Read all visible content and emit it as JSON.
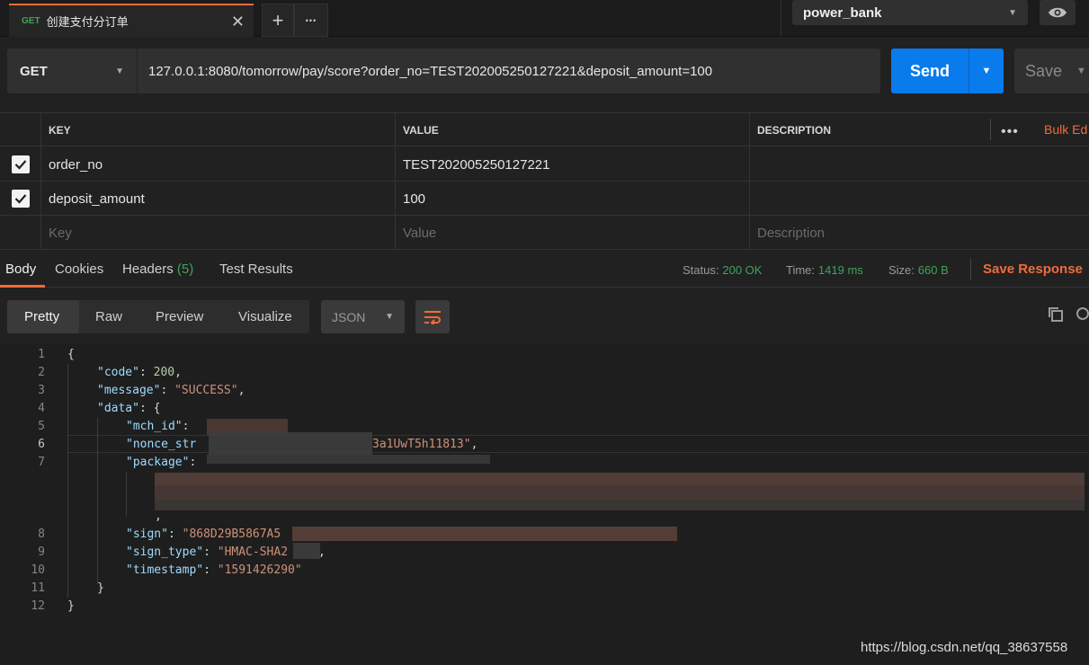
{
  "tab": {
    "method": "GET",
    "title": "创建支付分订单",
    "close": "✕",
    "add": "+",
    "more": "•••"
  },
  "environment": {
    "selected": "power_bank"
  },
  "request": {
    "method": "GET",
    "url": "127.0.0.1:8080/tomorrow/pay/score?order_no=TEST202005250127221&deposit_amount=100",
    "send_label": "Send",
    "save_label": "Save"
  },
  "params": {
    "headers": {
      "key": "KEY",
      "value": "VALUE",
      "description": "DESCRIPTION"
    },
    "bulk_edit": "Bulk Ed",
    "rows": [
      {
        "checked": true,
        "key": "order_no",
        "value": "TEST202005250127221"
      },
      {
        "checked": true,
        "key": "deposit_amount",
        "value": "100"
      }
    ],
    "placeholders": {
      "key": "Key",
      "value": "Value",
      "description": "Description"
    }
  },
  "response": {
    "tabs": {
      "body": "Body",
      "cookies": "Cookies",
      "headers": "Headers",
      "headers_count": "(5)",
      "test_results": "Test Results"
    },
    "status_label": "Status:",
    "status_value": "200 OK",
    "time_label": "Time:",
    "time_value": "1419 ms",
    "size_label": "Size:",
    "size_value": "660 B",
    "save_response": "Save Response",
    "views": {
      "pretty": "Pretty",
      "raw": "Raw",
      "preview": "Preview",
      "visualize": "Visualize"
    },
    "format": "JSON"
  },
  "editor": {
    "line_numbers": [
      "1",
      "2",
      "3",
      "4",
      "5",
      "6",
      "7",
      "8",
      "9",
      "10",
      "11",
      "12"
    ],
    "open_brace": "{",
    "close_brace": "}",
    "code_key": "\"code\"",
    "code_value": "200",
    "message_key": "\"message\"",
    "message_value": "\"SUCCESS\"",
    "data_key": "\"data\"",
    "mch_id_key": "\"mch_id\"",
    "nonce_key": "\"nonce_str",
    "nonce_tail": "3a1UwT5h11813\"",
    "package_key": "\"package\"",
    "sign_key": "\"sign\"",
    "sign_value": "\"868D29B5867A5",
    "sign_type_key": "\"sign_type\"",
    "sign_type_value": "\"HMAC-SHA2",
    "timestamp_key": "\"timestamp\"",
    "timestamp_value": "\"1591426290\""
  },
  "watermark": "https://blog.csdn.net/qq_38637558"
}
